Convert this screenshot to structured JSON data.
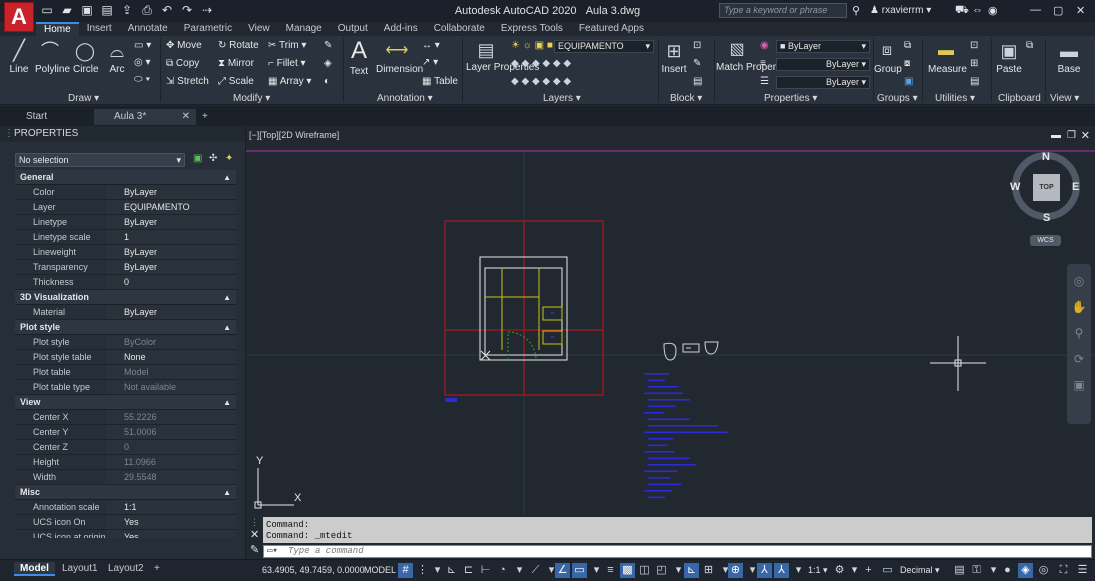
{
  "window": {
    "app_title": "Autodesk AutoCAD 2020",
    "file_name": "Aula 3.dwg",
    "search_placeholder": "Type a keyword or phrase",
    "user": "rxavierrm"
  },
  "ribbon_tabs": [
    "Home",
    "Insert",
    "Annotate",
    "Parametric",
    "View",
    "Manage",
    "Output",
    "Add-ins",
    "Collaborate",
    "Express Tools",
    "Featured Apps"
  ],
  "ribbon": {
    "draw": {
      "line": "Line",
      "polyline": "Polyline",
      "circle": "Circle",
      "arc": "Arc",
      "panel": "Draw"
    },
    "modify": {
      "move": "Move",
      "rotate": "Rotate",
      "trim": "Trim",
      "copy": "Copy",
      "mirror": "Mirror",
      "fillet": "Fillet",
      "stretch": "Stretch",
      "scale": "Scale",
      "array": "Array",
      "panel": "Modify"
    },
    "annotation": {
      "text": "Text",
      "dimension": "Dimension",
      "table": "Table",
      "panel": "Annotation"
    },
    "layers": {
      "layer_properties": "Layer Properties",
      "current_layer": "EQUIPAMENTO",
      "panel": "Layers"
    },
    "block": {
      "insert": "Insert",
      "panel": "Block"
    },
    "properties": {
      "match": "Match Properties",
      "color": "ByLayer",
      "linetype": "ByLayer",
      "lineweight": "ByLayer",
      "panel": "Properties"
    },
    "groups": {
      "group": "Group",
      "panel": "Groups"
    },
    "utilities": {
      "measure": "Measure",
      "panel": "Utilities"
    },
    "clipboard": {
      "paste": "Paste",
      "panel": "Clipboard"
    },
    "view": {
      "base": "Base",
      "panel": "View"
    }
  },
  "doc_tabs": {
    "start": "Start",
    "current": "Aula 3*"
  },
  "properties_panel": {
    "title": "PROPERTIES",
    "selection": "No selection",
    "sections": {
      "general": "General",
      "viz3d": "3D Visualization",
      "plot": "Plot style",
      "view": "View",
      "misc": "Misc"
    },
    "general": [
      {
        "k": "Color",
        "v": "ByLayer"
      },
      {
        "k": "Layer",
        "v": "EQUIPAMENTO"
      },
      {
        "k": "Linetype",
        "v": "ByLayer"
      },
      {
        "k": "Linetype scale",
        "v": "1"
      },
      {
        "k": "Lineweight",
        "v": "ByLayer"
      },
      {
        "k": "Transparency",
        "v": "ByLayer"
      },
      {
        "k": "Thickness",
        "v": "0"
      }
    ],
    "viz3d": [
      {
        "k": "Material",
        "v": "ByLayer"
      }
    ],
    "plot": [
      {
        "k": "Plot style",
        "v": "ByColor"
      },
      {
        "k": "Plot style table",
        "v": "None"
      },
      {
        "k": "Plot table attached to",
        "v": "Model"
      },
      {
        "k": "Plot table type",
        "v": "Not available"
      }
    ],
    "view": [
      {
        "k": "Center X",
        "v": "55.2226"
      },
      {
        "k": "Center Y",
        "v": "51.0006"
      },
      {
        "k": "Center Z",
        "v": "0"
      },
      {
        "k": "Height",
        "v": "11.0966"
      },
      {
        "k": "Width",
        "v": "29.5548"
      }
    ],
    "misc": [
      {
        "k": "Annotation scale",
        "v": "1:1"
      },
      {
        "k": "UCS icon On",
        "v": "Yes"
      },
      {
        "k": "UCS icon at origin",
        "v": "Yes"
      }
    ]
  },
  "viewport": {
    "label": "[−][Top][2D Wireframe]",
    "compass": {
      "n": "N",
      "s": "S",
      "e": "E",
      "w": "W",
      "top": "TOP",
      "wcs": "WCS"
    },
    "ucs": {
      "x": "X",
      "y": "Y"
    }
  },
  "command": {
    "line1": "Command:",
    "line2": "Command: _mtedit",
    "placeholder": "Type a command"
  },
  "status": {
    "model_tab": "Model",
    "layout1": "Layout1",
    "layout2": "Layout2",
    "coords": "63.4905, 49.7459, 0.0000",
    "space": "MODEL",
    "scale": "1:1",
    "units": "Decimal"
  },
  "colors": {
    "accent": "#3d8ee6",
    "frame_red": "#c8161d",
    "wall_white": "#e8e8e8",
    "furniture_yellow": "#c9c41a",
    "text_blue": "#2a2ad8",
    "magenta_line": "#b02bb0"
  }
}
